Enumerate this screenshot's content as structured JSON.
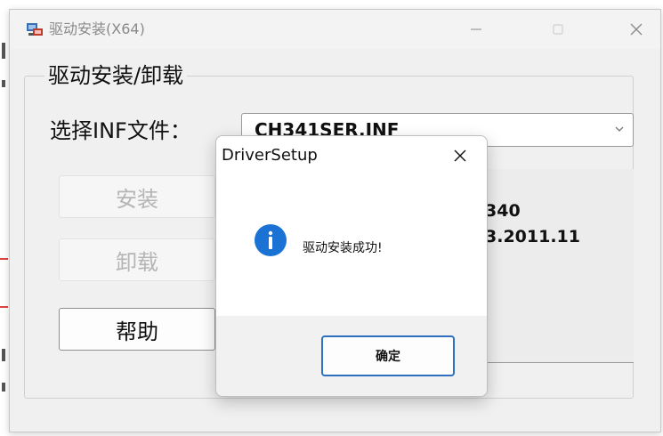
{
  "window": {
    "title": "驱动安装(X64)"
  },
  "group": {
    "label": "驱动安装/卸载",
    "inf_label": "选择INF文件：",
    "inf_value": "CH341SER.INF"
  },
  "buttons": {
    "install": "安装",
    "uninstall": "卸载",
    "help": "帮助"
  },
  "info": {
    "line1": "340",
    "line2": "3.2011.11"
  },
  "dialog": {
    "title": "DriverSetup",
    "message": "驱动安装成功!",
    "ok": "确定"
  },
  "colors": {
    "info_icon": "#1a73d4",
    "ok_border": "#2f6fbf"
  },
  "icons": {
    "app": "usb-driver-icon",
    "info": "info-icon",
    "close": "close-icon"
  }
}
